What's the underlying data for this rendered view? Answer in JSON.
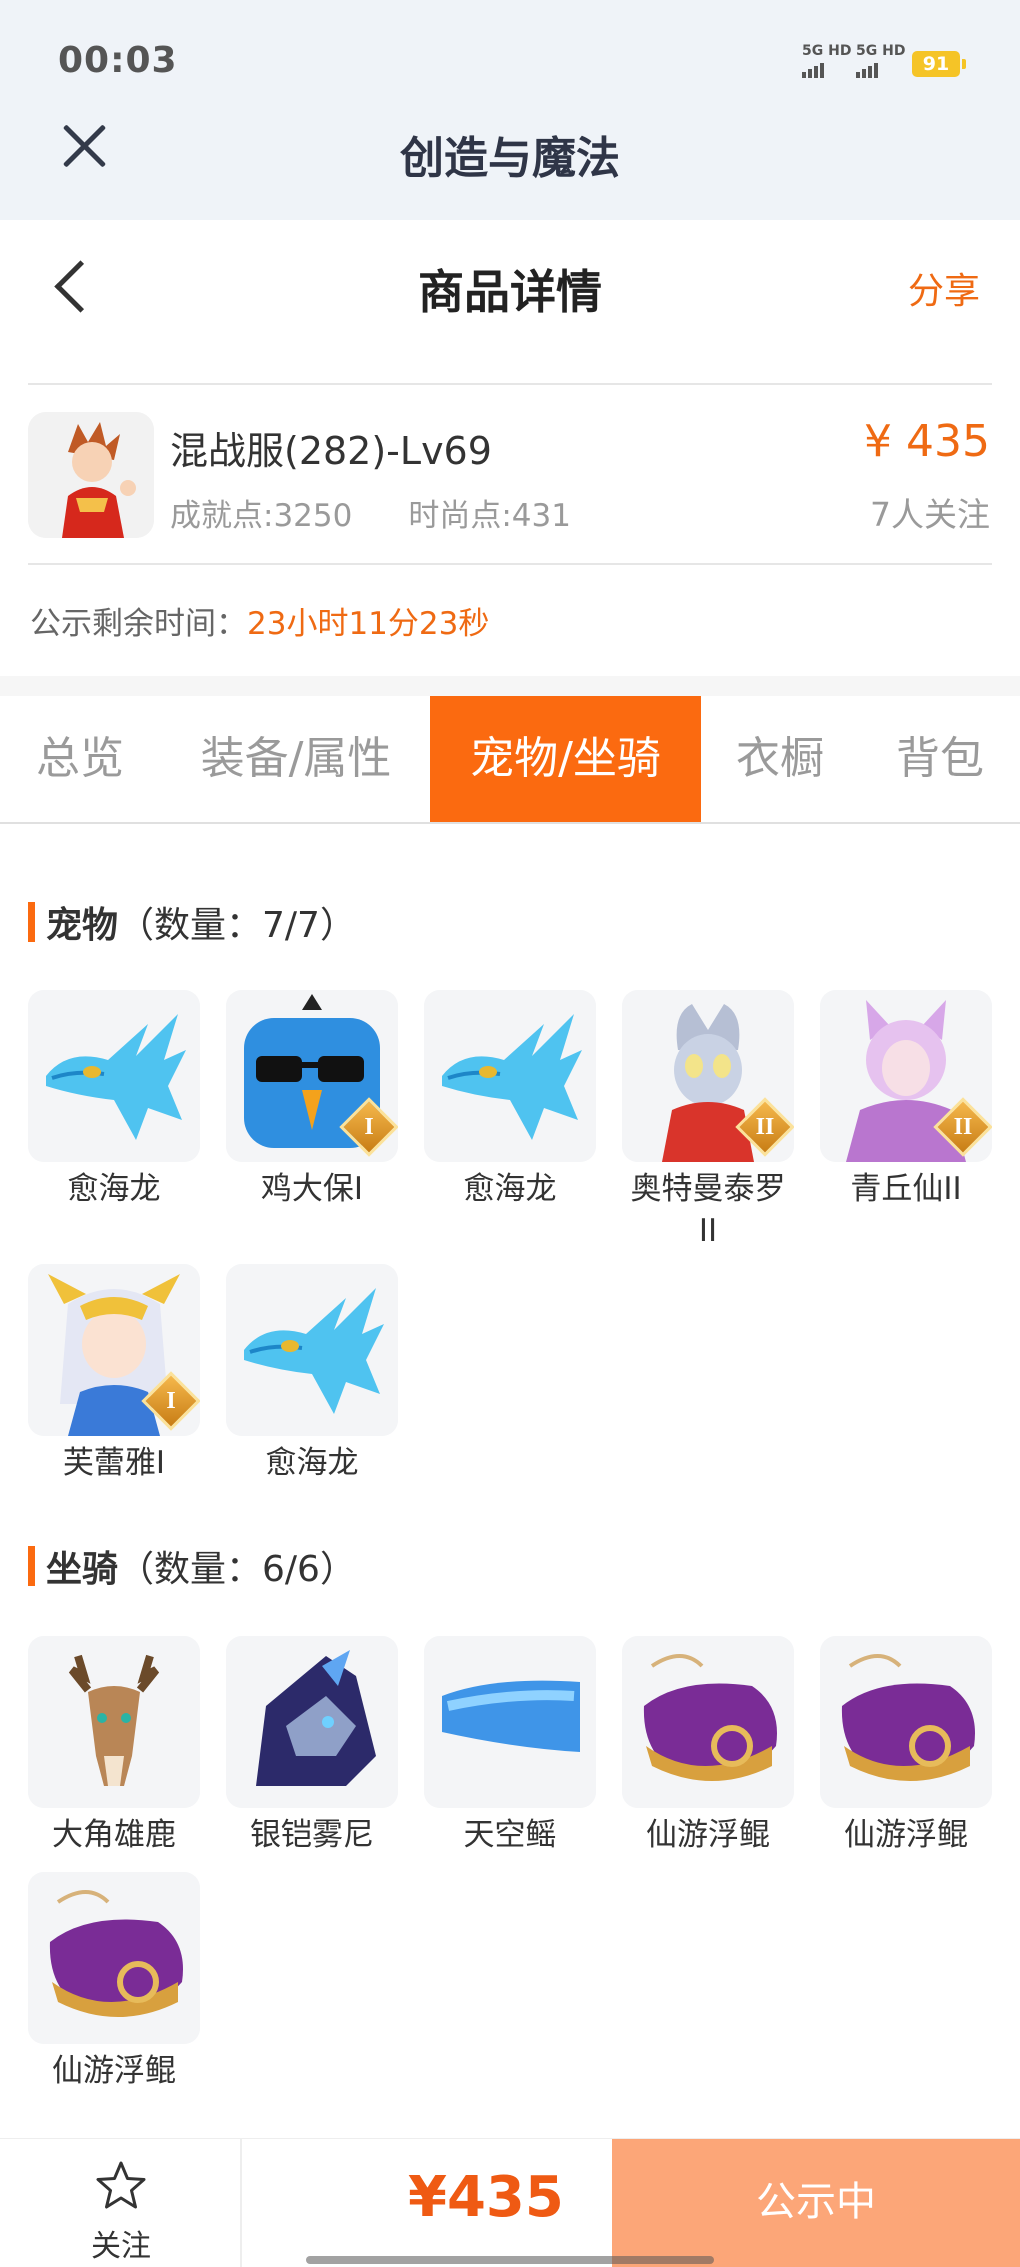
{
  "status_bar": {
    "time": "00:03",
    "sim1": "5G HD",
    "sim2": "5G HD",
    "battery": "91"
  },
  "app_bar": {
    "title": "创造与魔法"
  },
  "header": {
    "title": "商品详情",
    "share": "分享"
  },
  "product": {
    "name": "混战服(282)-Lv69",
    "achievement": "成就点:3250",
    "fashion": "时尚点:431",
    "price": "¥ 435",
    "followers": "7人关注",
    "notice_label": "公示剩余时间：",
    "notice_time": "23小时11分23秒"
  },
  "tabs": [
    {
      "label": "总览",
      "active": false
    },
    {
      "label": "装备/属性",
      "active": false
    },
    {
      "label": "宠物/坐骑",
      "active": true
    },
    {
      "label": "衣橱",
      "active": false
    },
    {
      "label": "背包",
      "active": false
    }
  ],
  "pets": {
    "title": "宠物",
    "count": "（数量：7/7）",
    "items": [
      {
        "name": "愈海龙",
        "icon": "sea-dragon-icon",
        "rank": ""
      },
      {
        "name": "鸡大保I",
        "icon": "chicken-icon",
        "rank": "I"
      },
      {
        "name": "愈海龙",
        "icon": "sea-dragon-icon",
        "rank": ""
      },
      {
        "name": "奥特曼泰罗II",
        "icon": "ultraman-icon",
        "rank": "II"
      },
      {
        "name": "青丘仙II",
        "icon": "fox-fairy-icon",
        "rank": "II"
      },
      {
        "name": "芙蕾雅I",
        "icon": "freya-icon",
        "rank": "I"
      },
      {
        "name": "愈海龙",
        "icon": "sea-dragon-icon",
        "rank": ""
      }
    ]
  },
  "mounts": {
    "title": "坐骑",
    "count": "（数量：6/6）",
    "items": [
      {
        "name": "大角雄鹿",
        "icon": "stag-icon"
      },
      {
        "name": "银铠雾尼",
        "icon": "armored-beast-icon"
      },
      {
        "name": "天空鳐",
        "icon": "sky-ray-icon"
      },
      {
        "name": "仙游浮鲲",
        "icon": "floating-kun-icon"
      },
      {
        "name": "仙游浮鲲",
        "icon": "floating-kun-icon"
      },
      {
        "name": "仙游浮鲲",
        "icon": "floating-kun-icon"
      }
    ]
  },
  "bottom_bar": {
    "follow_label": "关注",
    "price": "¥435",
    "status": "公示中"
  },
  "colors": {
    "accent": "#fb6a10",
    "price": "#ef6a13",
    "status_button": "#fca678"
  }
}
